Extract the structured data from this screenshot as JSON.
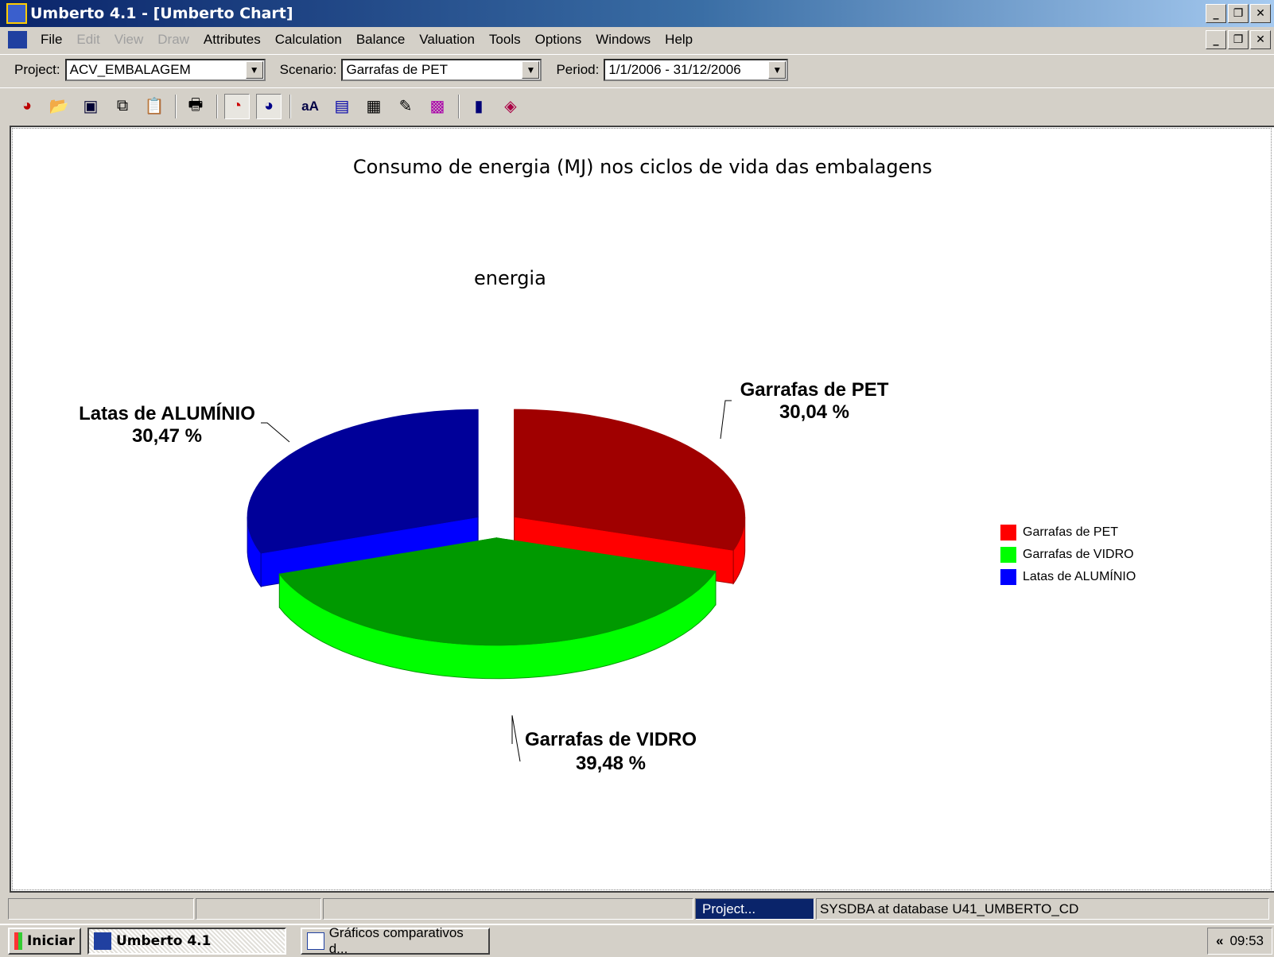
{
  "window": {
    "title": "Umberto 4.1 - [Umberto Chart]",
    "controls": [
      "_",
      "❐",
      "✕"
    ]
  },
  "menu": {
    "items": [
      {
        "label": "File",
        "enabled": true
      },
      {
        "label": "Edit",
        "enabled": false
      },
      {
        "label": "View",
        "enabled": false
      },
      {
        "label": "Draw",
        "enabled": false
      },
      {
        "label": "Attributes",
        "enabled": true
      },
      {
        "label": "Calculation",
        "enabled": true
      },
      {
        "label": "Balance",
        "enabled": true
      },
      {
        "label": "Valuation",
        "enabled": true
      },
      {
        "label": "Tools",
        "enabled": true
      },
      {
        "label": "Options",
        "enabled": true
      },
      {
        "label": "Windows",
        "enabled": true
      },
      {
        "label": "Help",
        "enabled": true
      }
    ]
  },
  "selectors": {
    "project_label": "Project:",
    "project_value": "ACV_EMBALAGEM",
    "scenario_label": "Scenario:",
    "scenario_value": "Garrafas de PET",
    "period_label": "Period:",
    "period_value": "1/1/2006 - 31/12/2006"
  },
  "toolbar_icons": [
    "new-chart-icon",
    "open-icon",
    "save-icon",
    "copy-icon",
    "paste-icon",
    "print-icon",
    "percent-pie-icon",
    "text-pie-icon",
    "font-size-icon",
    "chart-window-icon",
    "table-icon",
    "chart-wizard-icon",
    "color-palette-icon",
    "calculator-icon",
    "help-book-icon"
  ],
  "chart": {
    "title": "Consumo de energia (MJ) nos ciclos de vida das embalagens",
    "subtitle": "energia",
    "labels": [
      {
        "name": "Garrafas de PET",
        "value": "30,04 %"
      },
      {
        "name": "Garrafas de VIDRO",
        "value": "39,48 %"
      },
      {
        "name": "Latas de ALUMÍNIO",
        "value": "30,47 %"
      }
    ]
  },
  "chart_data": {
    "type": "pie",
    "title": "Consumo de energia (MJ) nos ciclos de vida das embalagens",
    "subtitle": "energia",
    "categories": [
      "Garrafas de PET",
      "Garrafas de VIDRO",
      "Latas de ALUMÍNIO"
    ],
    "values": [
      30.04,
      39.48,
      30.47
    ],
    "unit": "%",
    "colors": [
      "#ff0000",
      "#00ff00",
      "#0000ff"
    ],
    "dark_colors": [
      "#a00000",
      "#009900",
      "#000099"
    ],
    "exploded": true,
    "three_d": true,
    "legend_position": "right"
  },
  "statusbar": {
    "panels": [
      "",
      "",
      "",
      "Project...",
      "SYSDBA at database U41_UMBERTO_CD"
    ]
  },
  "taskbar": {
    "start_label": "Iniciar",
    "tasks": [
      "Umberto 4.1",
      "Gráficos comparativos d..."
    ],
    "tray_arrow": "«",
    "clock": "09:53"
  }
}
